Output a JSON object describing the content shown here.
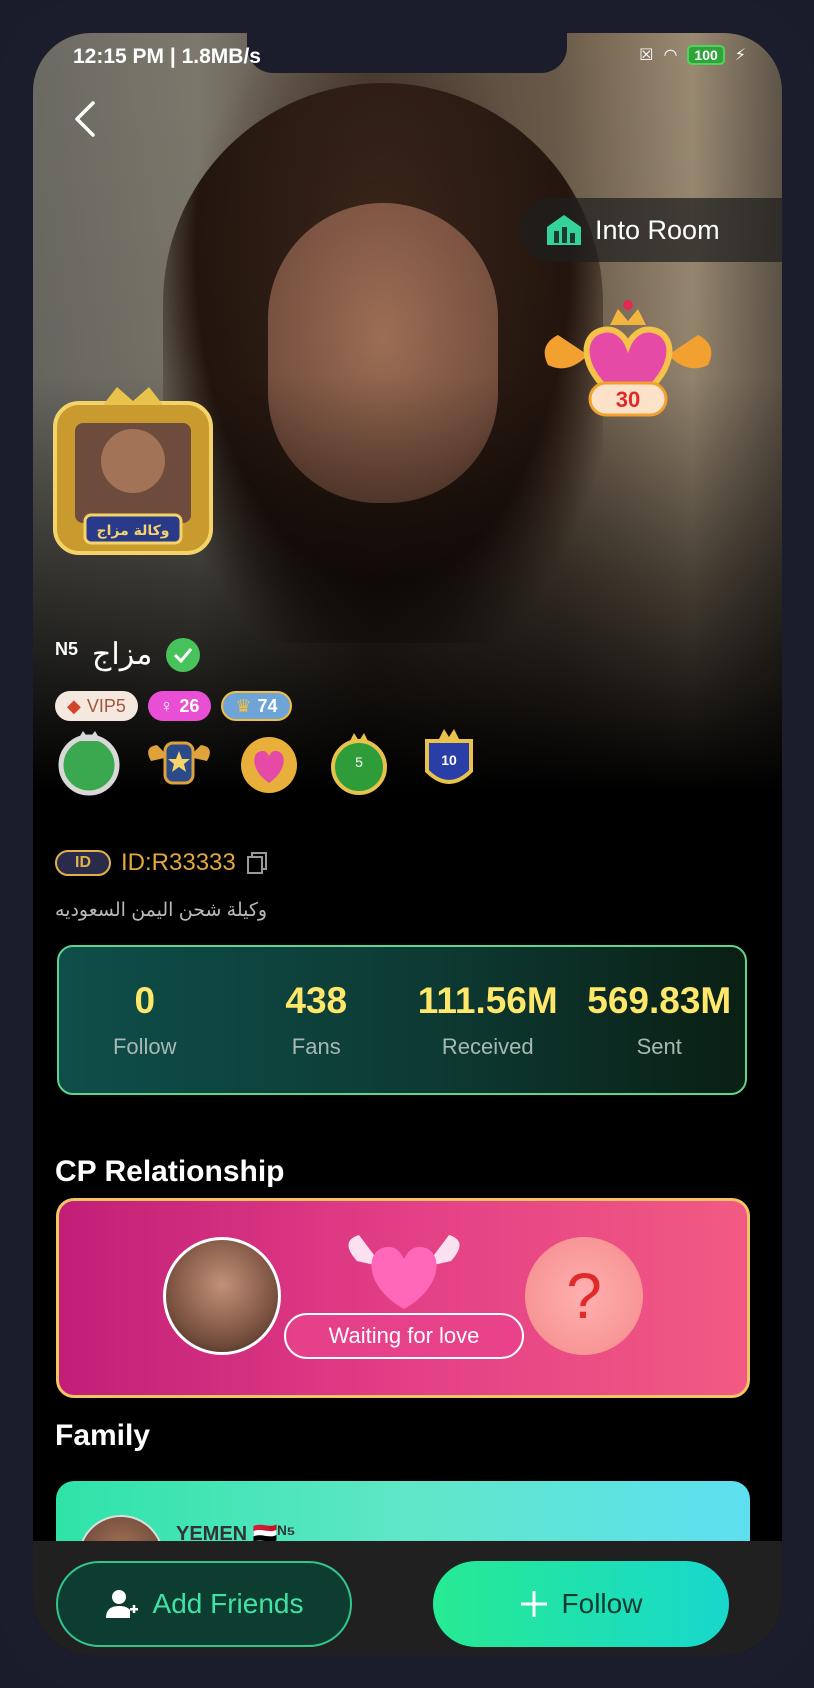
{
  "status_bar": {
    "time": "12:15 PM | 1.8MB/s",
    "battery": "100"
  },
  "header": {
    "back_icon": "back-chevron-icon",
    "into_room_label": "Into Room",
    "level_badge_value": "30"
  },
  "profile": {
    "frame_caption": "وكالة مزاج",
    "name_prefix": "N5",
    "name": "مزاج",
    "tags": {
      "vip": "VIP5",
      "gender_age": "26",
      "level": "74"
    },
    "id_badge": "ID",
    "id": "ID:R33333",
    "bio": "وكيلة شحن اليمن السعوديه"
  },
  "stats": [
    {
      "value": "0",
      "label": "Follow"
    },
    {
      "value": "438",
      "label": "Fans"
    },
    {
      "value": "111.56M",
      "label": "Received"
    },
    {
      "value": "569.83M",
      "label": "Sent"
    }
  ],
  "cp": {
    "title": "CP Relationship",
    "waiting_label": "Waiting for love",
    "unknown_mark": "?"
  },
  "family": {
    "title": "Family",
    "name": "YEMEN 🇾🇪ᴺ⁵"
  },
  "actions": {
    "add_friends": "Add Friends",
    "follow": "Follow"
  },
  "colors": {
    "accent_green": "#27ea93",
    "stat_value": "#ffe76a",
    "id_color": "#e2a83e",
    "cp_pink": "#e33f86"
  }
}
